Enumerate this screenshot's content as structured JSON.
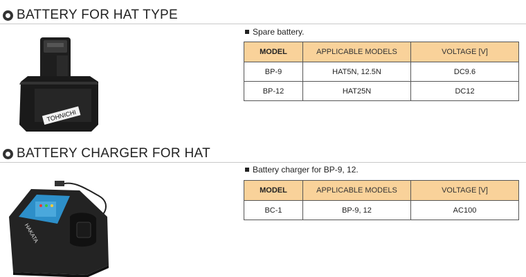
{
  "sections": [
    {
      "title": "BATTERY FOR HAT TYPE",
      "note": "Spare battery.",
      "image": {
        "description_icon": "battery-pack-image",
        "brand": "TOHNICHI"
      },
      "table": {
        "headers": [
          "MODEL",
          "APPLICABLE MODELS",
          "VOLTAGE [V]"
        ],
        "rows": [
          [
            "BP-9",
            "HAT5N, 12.5N",
            "DC9.6"
          ],
          [
            "BP-12",
            "HAT25N",
            "DC12"
          ]
        ]
      }
    },
    {
      "title": "BATTERY CHARGER FOR HAT",
      "note": "Battery charger for BP-9, 12.",
      "image": {
        "description_icon": "battery-charger-image",
        "brand": "HAKATA"
      },
      "table": {
        "headers": [
          "MODEL",
          "APPLICABLE MODELS",
          "VOLTAGE [V]"
        ],
        "rows": [
          [
            "BC-1",
            "BP-9, 12",
            "AC100"
          ]
        ]
      }
    }
  ],
  "colors": {
    "header_bg": "#f9d29a",
    "border": "#555555",
    "rule": "#c9c9c9"
  }
}
